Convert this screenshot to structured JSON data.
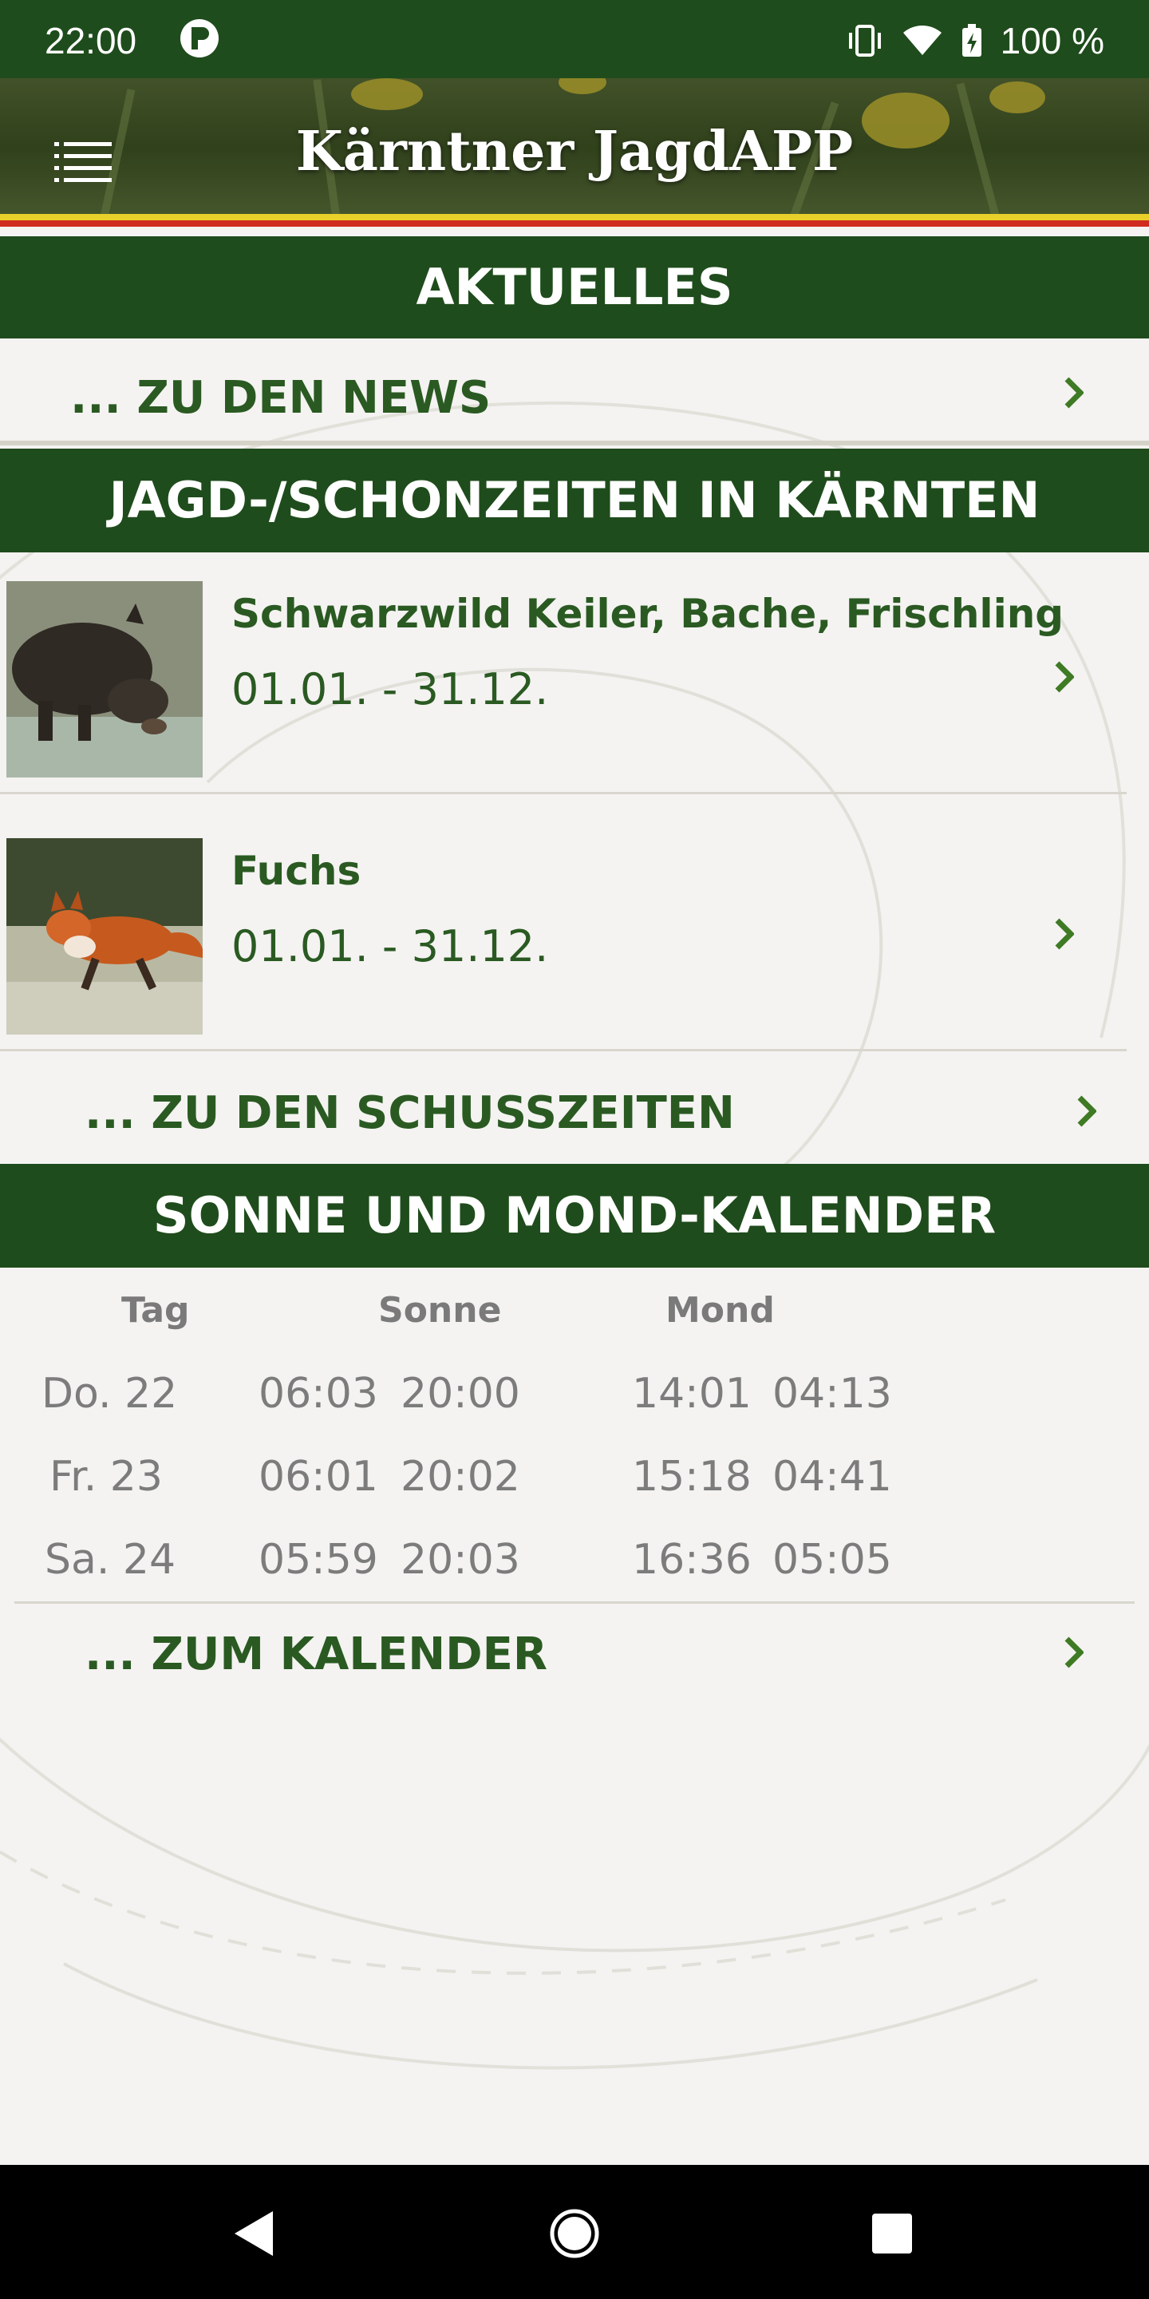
{
  "status_bar": {
    "time": "22:00",
    "battery": "100 %"
  },
  "header": {
    "title": "Kärntner JagdAPP"
  },
  "aktuelles": {
    "title": "AKTUELLES",
    "news_link": "... ZU DEN NEWS"
  },
  "jagdzeiten": {
    "title": "JAGD-/SCHONZEITEN IN KÄRNTEN",
    "items": [
      {
        "name": "Schwarzwild Keiler, Bache, Frischling",
        "dates": "01.01. - 31.12."
      },
      {
        "name": "Fuchs",
        "dates": "01.01. - 31.12."
      }
    ],
    "link": "... ZU DEN SCHUSSZEITEN"
  },
  "kalender": {
    "title": "SONNE UND MOND-KALENDER",
    "headers": {
      "tag": "Tag",
      "sonne": "Sonne",
      "mond": "Mond"
    },
    "rows": [
      {
        "tag": "Do. 22",
        "sun_rise": "06:03",
        "sun_set": "20:00",
        "moon_rise": "14:01",
        "moon_set": "04:13"
      },
      {
        "tag": "Fr. 23",
        "sun_rise": "06:01",
        "sun_set": "20:02",
        "moon_rise": "15:18",
        "moon_set": "04:41"
      },
      {
        "tag": "Sa. 24",
        "sun_rise": "05:59",
        "sun_set": "20:03",
        "moon_rise": "16:36",
        "moon_set": "05:05"
      }
    ],
    "link": "... ZUM KALENDER"
  },
  "colors": {
    "primary_green": "#1f4c1c",
    "text_green": "#2a5a22",
    "accent_chevron": "#3f7a25"
  }
}
